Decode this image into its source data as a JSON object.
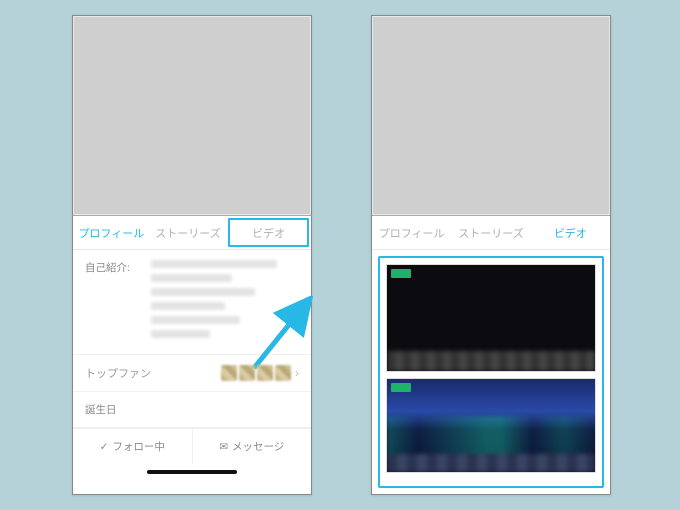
{
  "colors": {
    "accent": "#27b8e6",
    "live": "#1fb26a"
  },
  "tabs": {
    "profile": "プロフィール",
    "stories": "ストーリーズ",
    "video": "ビデオ"
  },
  "left": {
    "active_tab": "profile",
    "highlighted_tab": "video",
    "bio_label": "自己紹介:",
    "topfan_label": "トップファン",
    "birthday_label": "誕生日",
    "follow_label": "フォロー中",
    "message_label": "メッセージ"
  },
  "right": {
    "active_tab": "video"
  }
}
